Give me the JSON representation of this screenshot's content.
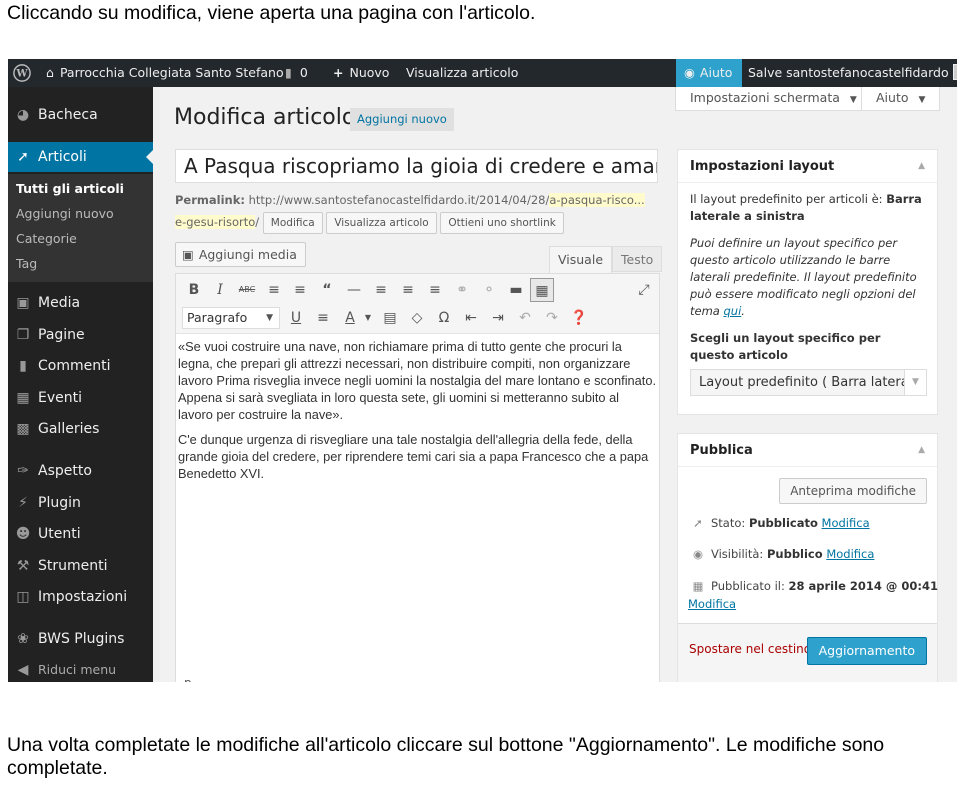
{
  "captions": {
    "top": "Cliccando su modifica, viene aperta una pagina con l'articolo.",
    "bottom": "Una volta completate le modifiche all'articolo cliccare sul bottone \"Aggiornamento\". Le modifiche sono completate."
  },
  "adminbar": {
    "site_name": "Parrocchia Collegiata Santo Stefano",
    "comments_count": "0",
    "new_label": "Nuovo",
    "view_label": "Visualizza articolo",
    "help_label": "Aiuto",
    "account_label": "Salve santostefanocastelfidardo"
  },
  "sidebar": {
    "items": [
      {
        "label": "Bacheca",
        "icon": "dashboard-icon"
      },
      {
        "label": "Articoli",
        "icon": "pin-icon"
      },
      {
        "label": "Media",
        "icon": "media-icon"
      },
      {
        "label": "Pagine",
        "icon": "pages-icon"
      },
      {
        "label": "Commenti",
        "icon": "comment-icon"
      },
      {
        "label": "Eventi",
        "icon": "calendar-icon"
      },
      {
        "label": "Galleries",
        "icon": "grid-icon"
      },
      {
        "label": "Aspetto",
        "icon": "brush-icon"
      },
      {
        "label": "Plugin",
        "icon": "plugin-icon"
      },
      {
        "label": "Utenti",
        "icon": "users-icon"
      },
      {
        "label": "Strumenti",
        "icon": "wrench-icon"
      },
      {
        "label": "Impostazioni",
        "icon": "settings-icon"
      },
      {
        "label": "BWS Plugins",
        "icon": "bws-icon"
      }
    ],
    "submenu": [
      "Tutti gli articoli",
      "Aggiungi nuovo",
      "Categorie",
      "Tag"
    ],
    "collapse_label": "Riduci menu"
  },
  "screen_options_label": "Impostazioni schermata",
  "help_tab_label": "Aiuto",
  "page_title": "Modifica articolo",
  "add_new_label": "Aggiungi nuovo",
  "post": {
    "title": "A Pasqua riscopriamo la gioia di credere e amare",
    "permalink_label": "Permalink:",
    "permalink_base": "http://www.santostefanocastelfidardo.it/2014/04/28/",
    "permalink_slug_1": "a-pasqua-risco...",
    "permalink_slug_2": "e-gesu-risorto",
    "permalink_slash": "/",
    "btn_edit": "Modifica",
    "btn_view": "Visualizza articolo",
    "btn_shortlink": "Ottieni uno shortlink"
  },
  "editor": {
    "add_media_label": "Aggiungi media",
    "tab_visual": "Visuale",
    "tab_text": "Testo",
    "format_value": "Paragrafo",
    "paragraph_1": "«Se vuoi costruire una nave, non richiamare prima di tutto gente che procuri la legna, che prepari gli attrezzi necessari, non distribuire compiti, non organizzare lavoro Prima risveglia invece negli uomini la nostalgia del mare lontano e sconfinato. Appena si sarà svegliata in loro questa sete, gli uomini si metteranno subito al lavoro per costruire la nave».",
    "paragraph_2": "C'e dunque urgenza di risvegliare una tale nostalgia dell'allegria della fede, della grande gioia del credere, per riprendere temi cari sia a papa Francesco che a papa Benedetto XVI.",
    "path_text": "p"
  },
  "layout_box": {
    "title": "Impostazioni layout",
    "default_text_prefix": "Il layout predefinito per articoli è: ",
    "default_text_bold": "Barra laterale a sinistra",
    "help_text": "Puoi definire un layout specifico per questo articolo utilizzando le barre laterali predefinite. Il layout predefinito può essere modificato negli opzioni del tema ",
    "help_link": "qui",
    "help_end": ".",
    "choose_label": "Scegli un layout specifico per questo articolo",
    "select_value": "Layout predefinito ( Barra laterale"
  },
  "publish_box": {
    "title": "Pubblica",
    "preview_label": "Anteprima modifiche",
    "status_label": "Stato:",
    "status_value": "Pubblicato",
    "visibility_label": "Visibilità:",
    "visibility_value": "Pubblico",
    "published_label": "Pubblicato il:",
    "published_value": "28 aprile 2014 @ 00:41",
    "edit_link": "Modifica",
    "trash_label": "Spostare nel cestino",
    "update_label": "Aggiornamento"
  },
  "colors": {
    "adminbar": "#23282d",
    "sidebar": "#222222",
    "accent": "#0074a2",
    "button_primary": "#2ea2cc"
  }
}
